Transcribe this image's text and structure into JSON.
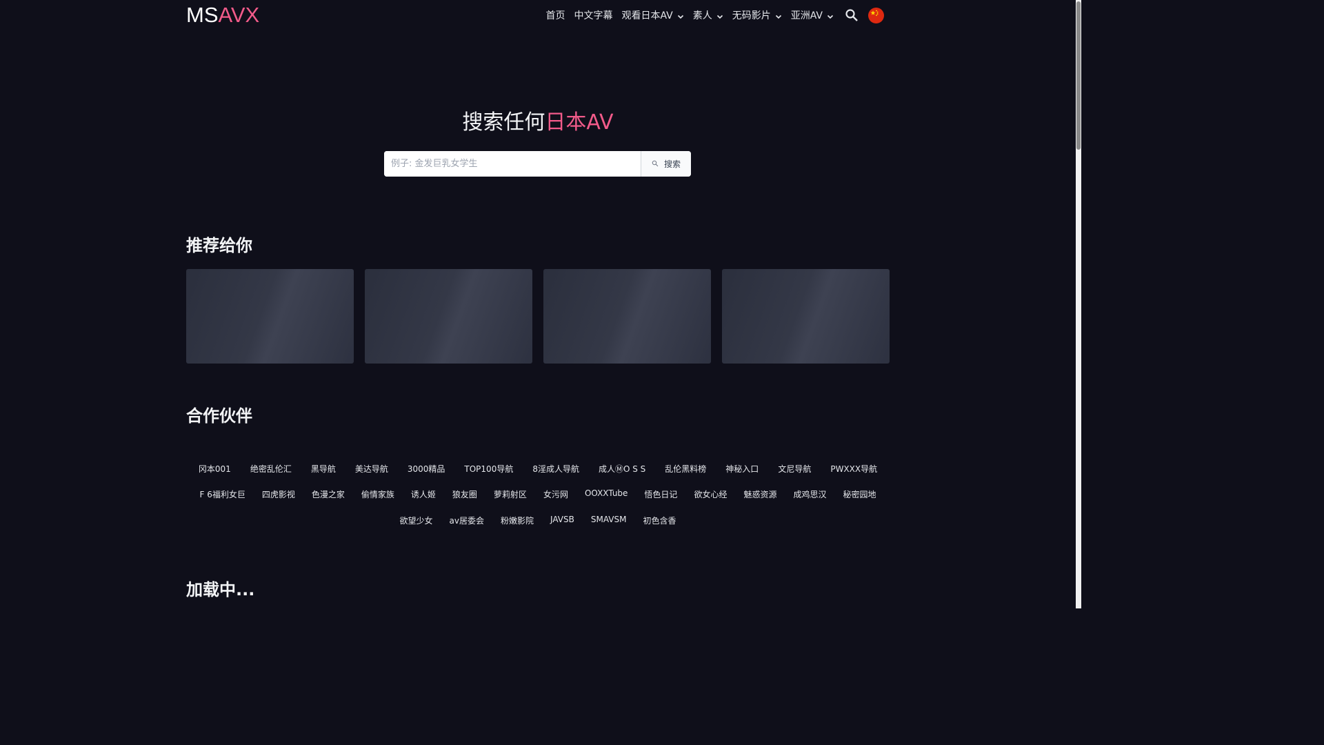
{
  "brand": {
    "prefix": "MS",
    "accent": "AVX"
  },
  "nav": {
    "items": [
      {
        "label": "首页",
        "dropdown": false
      },
      {
        "label": "中文字幕",
        "dropdown": false
      },
      {
        "label": "观看日本AV",
        "dropdown": true
      },
      {
        "label": "素人",
        "dropdown": true
      },
      {
        "label": "无码影片",
        "dropdown": true
      },
      {
        "label": "亚洲AV",
        "dropdown": true
      }
    ],
    "search_icon": "search-icon",
    "language_icon": "china-flag-icon"
  },
  "hero": {
    "title_prefix": "搜索任何",
    "title_accent": "日本AV",
    "placeholder": "例子: 金发巨乳女学生",
    "button_label": "搜索"
  },
  "sections": {
    "recommended": "推荐给你",
    "partners": "合作伙伴",
    "loading": "加载中..."
  },
  "partners": {
    "row1": [
      "冈本001",
      "绝密乱伦汇",
      "黑导航",
      "美达导航",
      "3000精品",
      "TOP100导航",
      "8淫成人导航",
      "成人ⓂO S S",
      "乱伦黑料榜",
      "神秘入口",
      "文尼导航",
      "PWXXX导航"
    ],
    "row2": [
      "F 6福利女巨",
      "四虎影视",
      "色漫之家",
      "偷情家族",
      "诱人姬",
      "狼友圈",
      "萝莉射区",
      "女污网",
      "OOXXTube",
      "悟色日记",
      "欲女心经",
      "魅惑资源",
      "成鸡思汉",
      "秘密园地"
    ],
    "row3": [
      "欲望少女",
      "av居委会",
      "粉嫩影院",
      "JAVSB",
      "SMAVSM",
      "初色含香"
    ]
  },
  "colors": {
    "background": "#0f0f1a",
    "accent": "#f25b8a",
    "card": "#343847"
  }
}
